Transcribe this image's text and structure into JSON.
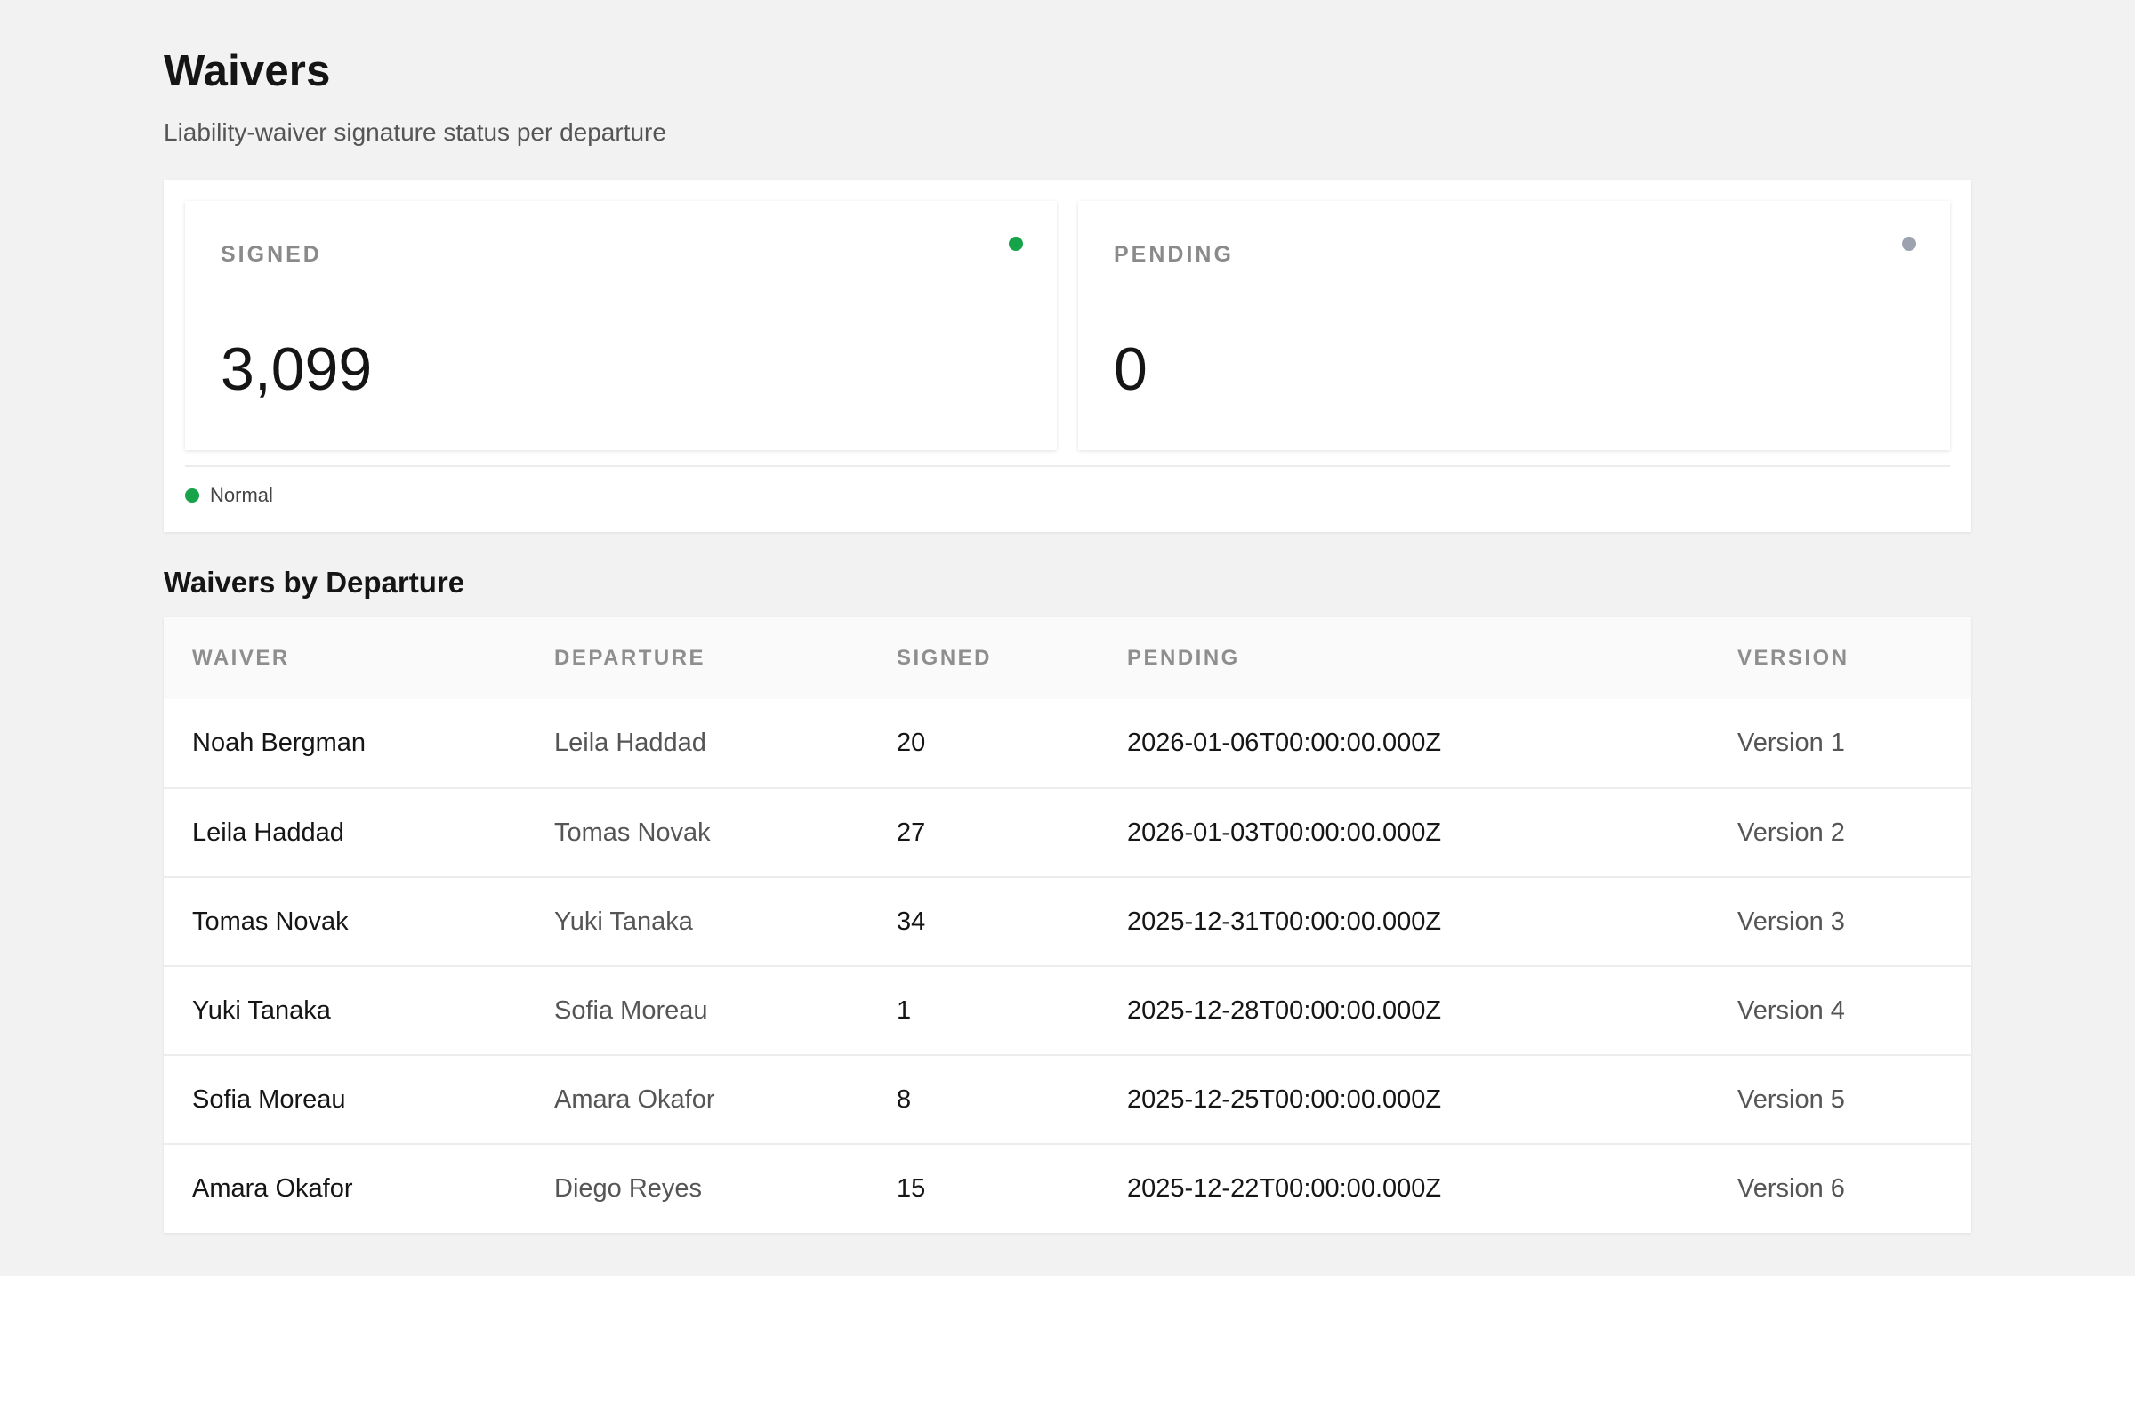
{
  "header": {
    "title": "Waivers",
    "subtitle": "Liability-waiver signature status per departure"
  },
  "kpis": [
    {
      "label": "SIGNED",
      "value": "3,099",
      "dot_color": "#16a34a"
    },
    {
      "label": "PENDING",
      "value": "0",
      "dot_color": "#9ca3af"
    }
  ],
  "legend": {
    "label": "Normal",
    "color": "#16a34a"
  },
  "section": {
    "title": "Waivers by Departure"
  },
  "table": {
    "columns": [
      "WAIVER",
      "DEPARTURE",
      "SIGNED",
      "PENDING",
      "VERSION"
    ],
    "rows": [
      {
        "waiver": "Noah Bergman",
        "departure": "Leila Haddad",
        "signed": "20",
        "pending": "2026-01-06T00:00:00.000Z",
        "version": "Version 1"
      },
      {
        "waiver": "Leila Haddad",
        "departure": "Tomas Novak",
        "signed": "27",
        "pending": "2026-01-03T00:00:00.000Z",
        "version": "Version 2"
      },
      {
        "waiver": "Tomas Novak",
        "departure": "Yuki Tanaka",
        "signed": "34",
        "pending": "2025-12-31T00:00:00.000Z",
        "version": "Version 3"
      },
      {
        "waiver": "Yuki Tanaka",
        "departure": "Sofia Moreau",
        "signed": "1",
        "pending": "2025-12-28T00:00:00.000Z",
        "version": "Version 4"
      },
      {
        "waiver": "Sofia Moreau",
        "departure": "Amara Okafor",
        "signed": "8",
        "pending": "2025-12-25T00:00:00.000Z",
        "version": "Version 5"
      },
      {
        "waiver": "Amara Okafor",
        "departure": "Diego Reyes",
        "signed": "15",
        "pending": "2025-12-22T00:00:00.000Z",
        "version": "Version 6"
      }
    ]
  }
}
